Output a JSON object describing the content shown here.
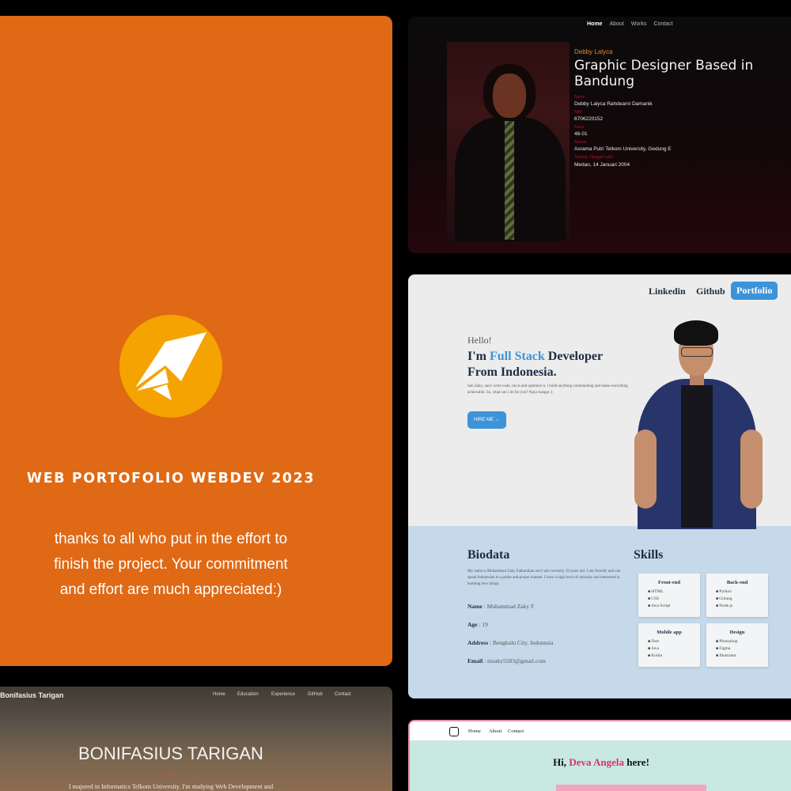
{
  "hero": {
    "title": "WEB PORTOFOLIO WEBDEV 2023",
    "lines": [
      "thanks to all who put in the effort to",
      "finish the project. Your commitment",
      "and effort are much appreciated:)"
    ],
    "colors": {
      "background": "#e06915",
      "logo": "#f5a300"
    },
    "logo_icon": "paper-plane-icon"
  },
  "debby": {
    "nav": [
      "Home",
      "About",
      "Works",
      "Contact"
    ],
    "subtitle": "Debby Lalyca",
    "title": "Graphic Designer Based in Bandung",
    "fields": [
      {
        "label": "Name",
        "value": "Debby Lalyca Rahdearni Damanik"
      },
      {
        "label": "NIM",
        "value": "6706220152"
      },
      {
        "label": "Kelas",
        "value": "46-01"
      },
      {
        "label": "Alamat",
        "value": "Asrama Putri Telkom University, Gedung E"
      },
      {
        "label": "Tempat, Tanggal Lahir",
        "value": "Medan, 14 Januari 2004"
      }
    ]
  },
  "zaky": {
    "nav": {
      "linkedin": "Linkedin",
      "github": "Github",
      "portfolio": "Portfolio"
    },
    "hello": "Hello!",
    "headline_pre": "I'm ",
    "headline_highlight": "Full Stack",
    "headline_post": " Developer From Indonesia.",
    "description": "Iam Zaky, and i write code, run it and optimize it, i build anything commanding and make everything achievable. So, what can i do for you? #jaya hangat :)",
    "hire_button": "HIRE ME →",
    "biodata_title": "Biodata",
    "biodata_text": "My name is Muhammad Zaky Fathurahan and I am currently 19 years old. I am friendly and can speak Indonesian in a polite and proper manner. I have a high level of curiosity and interested in learning new things.",
    "fields": [
      {
        "label": "Name",
        "value": " : Muhammad Zaky F"
      },
      {
        "label": "Age",
        "value": " : 19"
      },
      {
        "label": "Address",
        "value": " : Bengkulu City, Indonesia"
      },
      {
        "label": "Email",
        "value": " : mzaky5503@gmail.com"
      }
    ],
    "skills_title": "Skills",
    "skills": [
      {
        "title": "Front-end",
        "items": [
          "HTML",
          "CSS",
          "Java Script"
        ]
      },
      {
        "title": "Back-end",
        "items": [
          "Python",
          "Golang",
          "Node.js"
        ]
      },
      {
        "title": "Mobile app",
        "items": [
          "Dart",
          "Java",
          "Kotlin"
        ]
      },
      {
        "title": "Design",
        "items": [
          "Photoshop",
          "Figma",
          "Illustrator"
        ]
      }
    ],
    "colors": {
      "accent": "#3d93d8",
      "bottom": "#c6d9ea"
    }
  },
  "boni": {
    "name": "Bonifasius Tarigan",
    "nav": [
      "Home",
      "Education",
      "Experience",
      "GitHub",
      "Contact"
    ],
    "title": "BONIFASIUS TARIGAN",
    "description": "I majored in Informatics Telkom University. I'm studying Web Development and"
  },
  "deva": {
    "nav": [
      "Home",
      "About",
      "Contact"
    ],
    "hi_pre": "Hi, ",
    "hi_name": "Deva Angela",
    "hi_post": " here!",
    "colors": {
      "accent": "#d8306e",
      "background": "#c9e8e2"
    }
  }
}
